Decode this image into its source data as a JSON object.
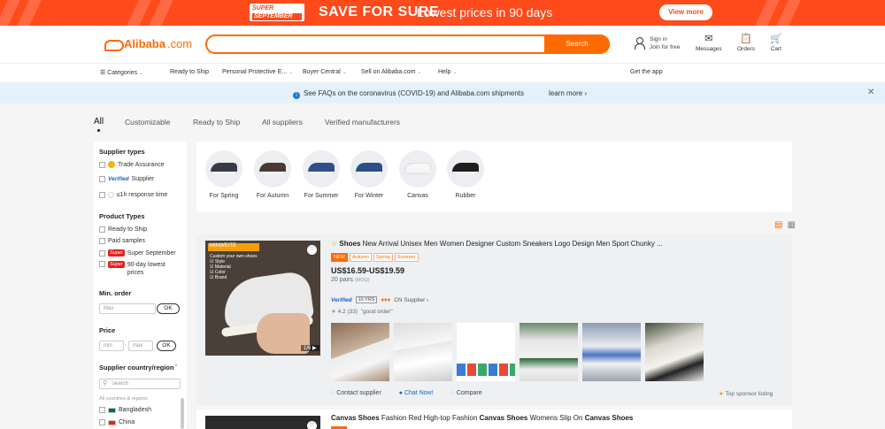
{
  "promo": {
    "tag_line1": "SUPER",
    "tag_line2": "SEPTEMBER",
    "headline": "SAVE FOR SURE",
    "subline": "Lowest prices in 90 days",
    "button": "View more"
  },
  "header": {
    "logo_name": "Alibaba",
    "logo_suffix": ".com",
    "search_value": "",
    "search_button": "Search",
    "signin": "Sign in",
    "join": "Join for free",
    "messages": "Messages",
    "orders": "Orders",
    "cart": "Cart"
  },
  "nav": {
    "categories": "Categories",
    "items": [
      "Ready to Ship",
      "Personal Protective E...",
      "Buyer Central",
      "Sell on Alibaba.com",
      "Help"
    ],
    "get_app": "Get the app"
  },
  "infobar": {
    "message": "See FAQs on the coronavirus (COVID-19) and Alibaba.com shipments",
    "link": "learn more"
  },
  "tabs": [
    "All",
    "Customizable",
    "Ready to Ship",
    "All suppliers",
    "Verified manufacturers"
  ],
  "sidebar": {
    "supplier_types_heading": "Supplier types",
    "trade_assurance": "Trade Assurance",
    "verified_badge": "Verified",
    "supplier": "Supplier",
    "response": "≤1h response time",
    "product_types_heading": "Product Types",
    "ready_to_ship": "Ready to Ship",
    "paid_samples": "Paid samples",
    "super_badge": "Super",
    "super_september": "Super September",
    "lowest_line1": "90-day lowest",
    "lowest_line2": "prices",
    "min_order_heading": "Min. order",
    "min_placeholder": "Max",
    "ok": "OK",
    "price_heading": "Price",
    "price_min": "min",
    "price_max": "max",
    "country_heading": "Supplier country/region",
    "country_search": "search",
    "all_countries": "All countries & regions",
    "countries": [
      "Bangladesh",
      "China"
    ]
  },
  "categories": [
    {
      "label": "For Spring",
      "color": "#3a3a44"
    },
    {
      "label": "For Autumn",
      "color": "#4a3a33"
    },
    {
      "label": "For Summer",
      "color": "#2f4f8c"
    },
    {
      "label": "For Winter",
      "color": "#2c4e8a"
    },
    {
      "label": "Canvas",
      "color": "#f7f7f7"
    },
    {
      "label": "Rubber",
      "color": "#1e1e1e"
    }
  ],
  "product1": {
    "title_bold": "Shoes",
    "title_rest": " New Arrival Unisex Men Women Designer Custom Sneakers Logo Design Men Sport Chunky ...",
    "tags": [
      "NEW",
      "Autumn",
      "Spring",
      "Summer"
    ],
    "price": "US$16.59-US$19.59",
    "moq": "20 pairs",
    "moq_unit": "(MOQ)",
    "verified": "Verified",
    "years": "10 YRS",
    "country": "CN Supplier",
    "rating": "4.2 (33)",
    "review": "\"good order\"",
    "image_tag": "MINWEITE",
    "image_text": "Custom your own shoes\n☑ Style\n☑ Material\n☑ Color\n☑ Brand",
    "image_counter": "1/6",
    "contact": "Contact supplier",
    "chat": "Chat Now!",
    "compare": "Compare",
    "sponsor": "Top sponsor listing"
  },
  "product2": {
    "title_html_parts": [
      "Canvas Shoes",
      " Fashion Red High-top Fashion ",
      "Canvas Shoes",
      " Womens Slip On ",
      "Canvas Shoes"
    ]
  }
}
